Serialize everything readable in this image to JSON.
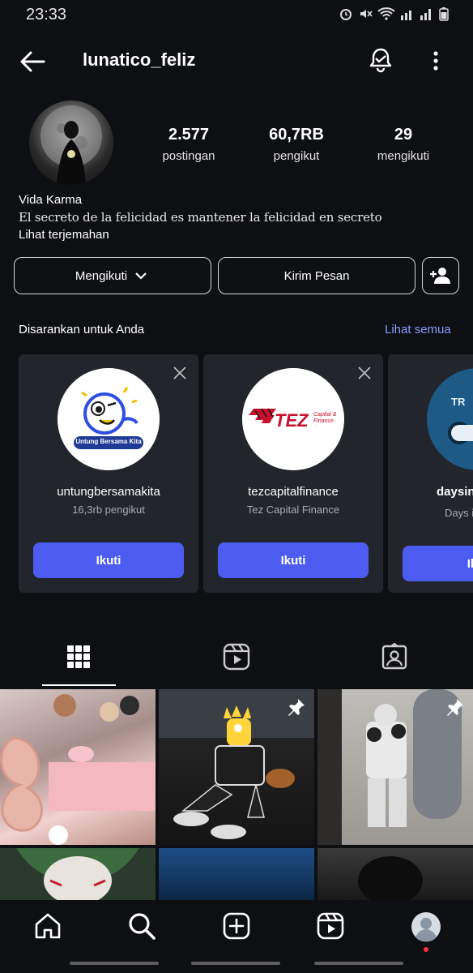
{
  "status_bar": {
    "time": "23:33"
  },
  "header": {
    "username": "lunatico_feliz"
  },
  "profile": {
    "stats": [
      {
        "value": "2.577",
        "label": "postingan"
      },
      {
        "value": "60,7RB",
        "label": "pengikut"
      },
      {
        "value": "29",
        "label": "mengikuti"
      }
    ],
    "bio_name": "Vida Karma",
    "bio_text": "El secreto de la felicidad es mantener la felicidad en secreto",
    "translate_link": "Lihat terjemahan"
  },
  "actions": {
    "following_label": "Mengikuti",
    "message_label": "Kirim Pesan"
  },
  "suggestions": {
    "title": "Disarankan untuk Anda",
    "see_all": "Lihat semua",
    "cards": [
      {
        "name": "untungbersamakita",
        "subtitle": "16,3rb pengikut",
        "button": "Ikuti",
        "logo_text": "Untung Bersama Kita"
      },
      {
        "name": "tezcapitalfinance",
        "subtitle": "Tez Capital Finance",
        "button": "Ikuti",
        "logo_text": "TEZ",
        "logo_small": "Capital & Finance"
      },
      {
        "name": "daysin",
        "subtitle": "Days i",
        "button": "Ik",
        "logo_text": "TR"
      }
    ]
  },
  "colors": {
    "accent": "#4d5cf0",
    "link": "#8a9cff",
    "background": "#0e0f13",
    "card": "#22252c"
  }
}
